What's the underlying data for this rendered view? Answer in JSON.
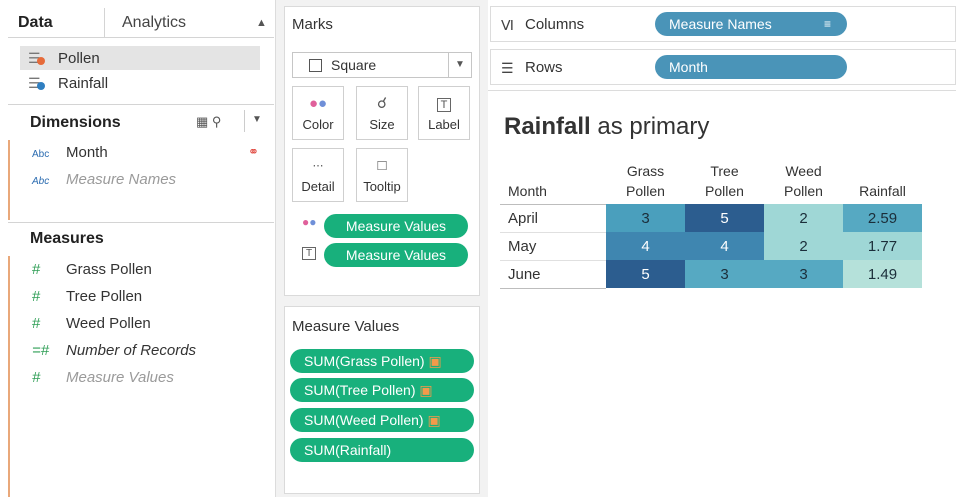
{
  "tabs": {
    "data": "Data",
    "analytics": "Analytics"
  },
  "datasources": [
    {
      "name": "Pollen",
      "color": "#e66b3a"
    },
    {
      "name": "Rainfall",
      "color": "#2f7fc1"
    }
  ],
  "dimensions": {
    "title": "Dimensions",
    "fields": [
      {
        "type": "Abc",
        "name": "Month"
      },
      {
        "type": "Abc",
        "name": "Measure Names"
      }
    ]
  },
  "measures": {
    "title": "Measures",
    "fields": [
      "Grass Pollen",
      "Tree Pollen",
      "Weed Pollen",
      "Number of Records",
      "Measure Values"
    ]
  },
  "marks": {
    "title": "Marks",
    "mark_type": "Square",
    "buttons": [
      "Color",
      "Size",
      "Label",
      "Detail",
      "Tooltip"
    ],
    "color_pill": "Measure Values",
    "label_pill": "Measure Values"
  },
  "measure_values": {
    "title": "Measure Values",
    "pills": [
      "SUM(Grass Pollen)",
      "SUM(Tree Pollen)",
      "SUM(Weed Pollen)",
      "SUM(Rainfall)"
    ]
  },
  "shelves": {
    "columns_label": "Columns",
    "columns_pill": "Measure Names",
    "rows_label": "Rows",
    "rows_pill": "Month"
  },
  "viz": {
    "title_bold": "Rainfall",
    "title_rest": " as primary",
    "row_header": "Month",
    "col_headers": [
      [
        "Grass",
        "Pollen"
      ],
      [
        "Tree",
        "Pollen"
      ],
      [
        "Weed",
        "Pollen"
      ],
      [
        "",
        "Rainfall"
      ]
    ],
    "rows": [
      {
        "month": "April",
        "values": [
          "3",
          "5",
          "2",
          "2.59"
        ]
      },
      {
        "month": "May",
        "values": [
          "4",
          "4",
          "2",
          "1.77"
        ]
      },
      {
        "month": "June",
        "values": [
          "5",
          "3",
          "3",
          "1.49"
        ]
      }
    ],
    "cell_colors": [
      [
        "#4a9fbd",
        "#2c5d8f",
        "#9fd7d6",
        "#56a9c2"
      ],
      [
        "#3f86b0",
        "#3f86b0",
        "#9fd7d6",
        "#9fd7d6"
      ],
      [
        "#2c5d8f",
        "#56a9c2",
        "#56a9c2",
        "#b5e1da"
      ]
    ],
    "cell_text_colors": [
      [
        "#1b2e3a",
        "#ffffff",
        "#1b2e3a",
        "#1b2e3a"
      ],
      [
        "#ffffff",
        "#ffffff",
        "#1b2e3a",
        "#1b2e3a"
      ],
      [
        "#ffffff",
        "#1b2e3a",
        "#1b2e3a",
        "#1b2e3a"
      ]
    ]
  }
}
